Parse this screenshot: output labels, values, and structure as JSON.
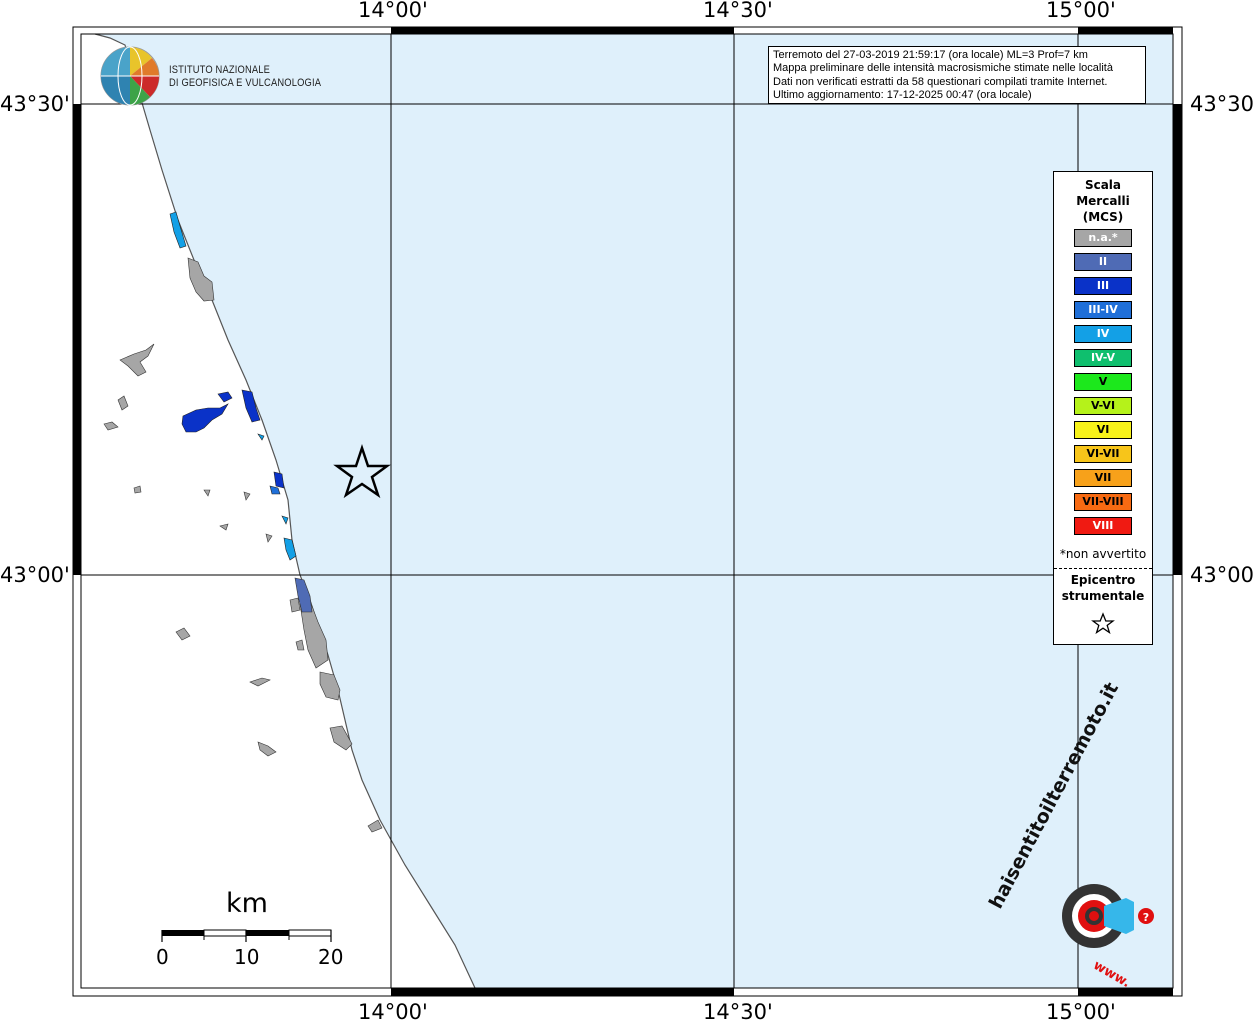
{
  "map": {
    "lon_labels": [
      "14°00'",
      "14°30'",
      "15°00'"
    ],
    "lat_labels": [
      "43°30'",
      "43°00'"
    ],
    "colors": {
      "sea": "#dff0fb",
      "land": "#ffffff",
      "coast": "#555555",
      "grid": "#000000",
      "not_felt": "#a6a6a6"
    }
  },
  "info": {
    "line1": "Terremoto del 27-03-2019 21:59:17 (ora locale) ML=3 Prof=7 km",
    "line2": "Mappa preliminare delle intensità macrosismiche stimate nelle località",
    "line3": "Dati non verificati estratti da 58 questionari compilati tramite Internet.",
    "line4": "Ultimo aggiornamento: 17-12-2025 00:47 (ora locale)"
  },
  "logo": {
    "line1": "ISTITUTO NAZIONALE",
    "line2": "DI GEOFISICA E VULCANOLOGIA"
  },
  "legend": {
    "title1": "Scala",
    "title2": "Mercalli",
    "title3": "(MCS)",
    "items": [
      {
        "label": "n.a.*",
        "color": "#a6a6a6"
      },
      {
        "label": "II",
        "color": "#4f6bb5"
      },
      {
        "label": "III",
        "color": "#0a32c8"
      },
      {
        "label": "III-IV",
        "color": "#1f6fd8"
      },
      {
        "label": "IV",
        "color": "#13a0e6"
      },
      {
        "label": "IV-V",
        "color": "#0fbf6e"
      },
      {
        "label": "V",
        "color": "#1ce81c"
      },
      {
        "label": "V-VI",
        "color": "#b5f21a"
      },
      {
        "label": "VI",
        "color": "#f7f21a"
      },
      {
        "label": "VI-VII",
        "color": "#f7c51a"
      },
      {
        "label": "VII",
        "color": "#f7a11a"
      },
      {
        "label": "VII-VIII",
        "color": "#f76a12"
      },
      {
        "label": "VIII",
        "color": "#f01a12"
      }
    ],
    "na_note": "*non avvertito",
    "epicentre1": "Epicentro",
    "epicentre2": "strumentale"
  },
  "scale": {
    "unit": "km",
    "ticks": [
      "0",
      "10",
      "20"
    ]
  },
  "brand": {
    "site": "haisentitoilterremoto.it",
    "prefix": "www."
  }
}
